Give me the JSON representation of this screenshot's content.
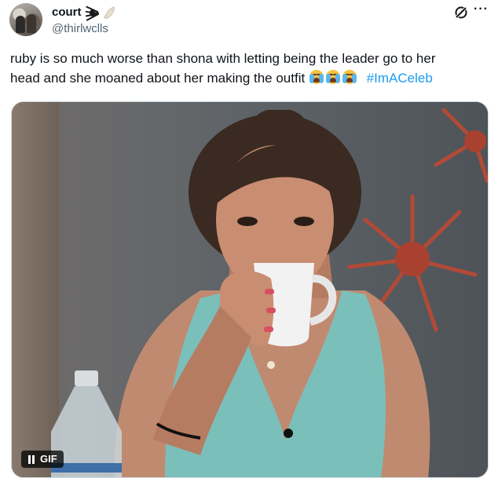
{
  "author": {
    "display_name": "court",
    "handle": "@thirlwclls",
    "name_emojis": [
      "spider-icon",
      "shell-icon"
    ]
  },
  "tweet": {
    "text_line1": "ruby is so much worse than shona with letting being the leader go to her",
    "text_line2": "head and she moaned about her making the outfit",
    "emojis": [
      "loudly-crying-face-icon",
      "loudly-crying-face-icon",
      "loudly-crying-face-icon"
    ],
    "hashtag": "#ImACeleb"
  },
  "media": {
    "type": "gif",
    "badge_label": "GIF",
    "playback_icon": "pause-icon"
  },
  "header_icons": [
    "grok-icon",
    "more-icon"
  ],
  "colors": {
    "text": "#0f1419",
    "secondary": "#536471",
    "link": "#1d9bf0",
    "border": "#cfd9de"
  }
}
